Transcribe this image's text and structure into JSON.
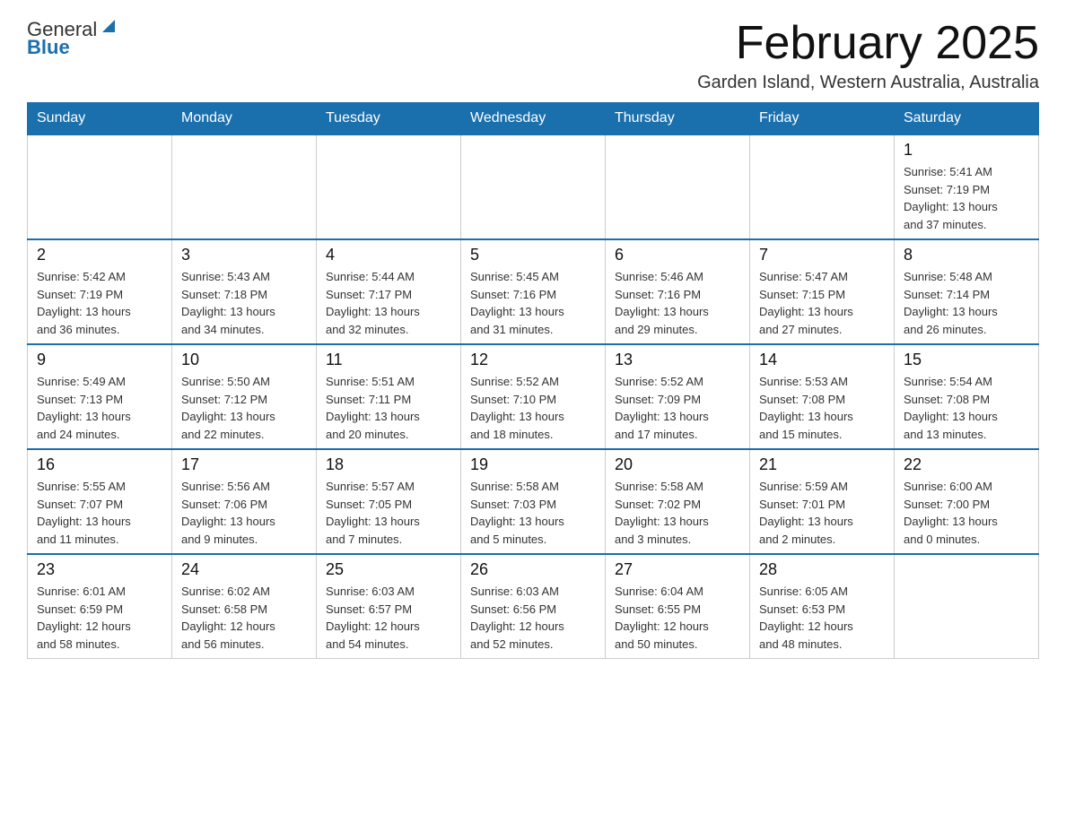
{
  "logo": {
    "text_general": "General",
    "text_blue": "Blue"
  },
  "title": "February 2025",
  "subtitle": "Garden Island, Western Australia, Australia",
  "weekdays": [
    "Sunday",
    "Monday",
    "Tuesday",
    "Wednesday",
    "Thursday",
    "Friday",
    "Saturday"
  ],
  "weeks": [
    [
      {
        "day": "",
        "info": ""
      },
      {
        "day": "",
        "info": ""
      },
      {
        "day": "",
        "info": ""
      },
      {
        "day": "",
        "info": ""
      },
      {
        "day": "",
        "info": ""
      },
      {
        "day": "",
        "info": ""
      },
      {
        "day": "1",
        "info": "Sunrise: 5:41 AM\nSunset: 7:19 PM\nDaylight: 13 hours\nand 37 minutes."
      }
    ],
    [
      {
        "day": "2",
        "info": "Sunrise: 5:42 AM\nSunset: 7:19 PM\nDaylight: 13 hours\nand 36 minutes."
      },
      {
        "day": "3",
        "info": "Sunrise: 5:43 AM\nSunset: 7:18 PM\nDaylight: 13 hours\nand 34 minutes."
      },
      {
        "day": "4",
        "info": "Sunrise: 5:44 AM\nSunset: 7:17 PM\nDaylight: 13 hours\nand 32 minutes."
      },
      {
        "day": "5",
        "info": "Sunrise: 5:45 AM\nSunset: 7:16 PM\nDaylight: 13 hours\nand 31 minutes."
      },
      {
        "day": "6",
        "info": "Sunrise: 5:46 AM\nSunset: 7:16 PM\nDaylight: 13 hours\nand 29 minutes."
      },
      {
        "day": "7",
        "info": "Sunrise: 5:47 AM\nSunset: 7:15 PM\nDaylight: 13 hours\nand 27 minutes."
      },
      {
        "day": "8",
        "info": "Sunrise: 5:48 AM\nSunset: 7:14 PM\nDaylight: 13 hours\nand 26 minutes."
      }
    ],
    [
      {
        "day": "9",
        "info": "Sunrise: 5:49 AM\nSunset: 7:13 PM\nDaylight: 13 hours\nand 24 minutes."
      },
      {
        "day": "10",
        "info": "Sunrise: 5:50 AM\nSunset: 7:12 PM\nDaylight: 13 hours\nand 22 minutes."
      },
      {
        "day": "11",
        "info": "Sunrise: 5:51 AM\nSunset: 7:11 PM\nDaylight: 13 hours\nand 20 minutes."
      },
      {
        "day": "12",
        "info": "Sunrise: 5:52 AM\nSunset: 7:10 PM\nDaylight: 13 hours\nand 18 minutes."
      },
      {
        "day": "13",
        "info": "Sunrise: 5:52 AM\nSunset: 7:09 PM\nDaylight: 13 hours\nand 17 minutes."
      },
      {
        "day": "14",
        "info": "Sunrise: 5:53 AM\nSunset: 7:08 PM\nDaylight: 13 hours\nand 15 minutes."
      },
      {
        "day": "15",
        "info": "Sunrise: 5:54 AM\nSunset: 7:08 PM\nDaylight: 13 hours\nand 13 minutes."
      }
    ],
    [
      {
        "day": "16",
        "info": "Sunrise: 5:55 AM\nSunset: 7:07 PM\nDaylight: 13 hours\nand 11 minutes."
      },
      {
        "day": "17",
        "info": "Sunrise: 5:56 AM\nSunset: 7:06 PM\nDaylight: 13 hours\nand 9 minutes."
      },
      {
        "day": "18",
        "info": "Sunrise: 5:57 AM\nSunset: 7:05 PM\nDaylight: 13 hours\nand 7 minutes."
      },
      {
        "day": "19",
        "info": "Sunrise: 5:58 AM\nSunset: 7:03 PM\nDaylight: 13 hours\nand 5 minutes."
      },
      {
        "day": "20",
        "info": "Sunrise: 5:58 AM\nSunset: 7:02 PM\nDaylight: 13 hours\nand 3 minutes."
      },
      {
        "day": "21",
        "info": "Sunrise: 5:59 AM\nSunset: 7:01 PM\nDaylight: 13 hours\nand 2 minutes."
      },
      {
        "day": "22",
        "info": "Sunrise: 6:00 AM\nSunset: 7:00 PM\nDaylight: 13 hours\nand 0 minutes."
      }
    ],
    [
      {
        "day": "23",
        "info": "Sunrise: 6:01 AM\nSunset: 6:59 PM\nDaylight: 12 hours\nand 58 minutes."
      },
      {
        "day": "24",
        "info": "Sunrise: 6:02 AM\nSunset: 6:58 PM\nDaylight: 12 hours\nand 56 minutes."
      },
      {
        "day": "25",
        "info": "Sunrise: 6:03 AM\nSunset: 6:57 PM\nDaylight: 12 hours\nand 54 minutes."
      },
      {
        "day": "26",
        "info": "Sunrise: 6:03 AM\nSunset: 6:56 PM\nDaylight: 12 hours\nand 52 minutes."
      },
      {
        "day": "27",
        "info": "Sunrise: 6:04 AM\nSunset: 6:55 PM\nDaylight: 12 hours\nand 50 minutes."
      },
      {
        "day": "28",
        "info": "Sunrise: 6:05 AM\nSunset: 6:53 PM\nDaylight: 12 hours\nand 48 minutes."
      },
      {
        "day": "",
        "info": ""
      }
    ]
  ]
}
